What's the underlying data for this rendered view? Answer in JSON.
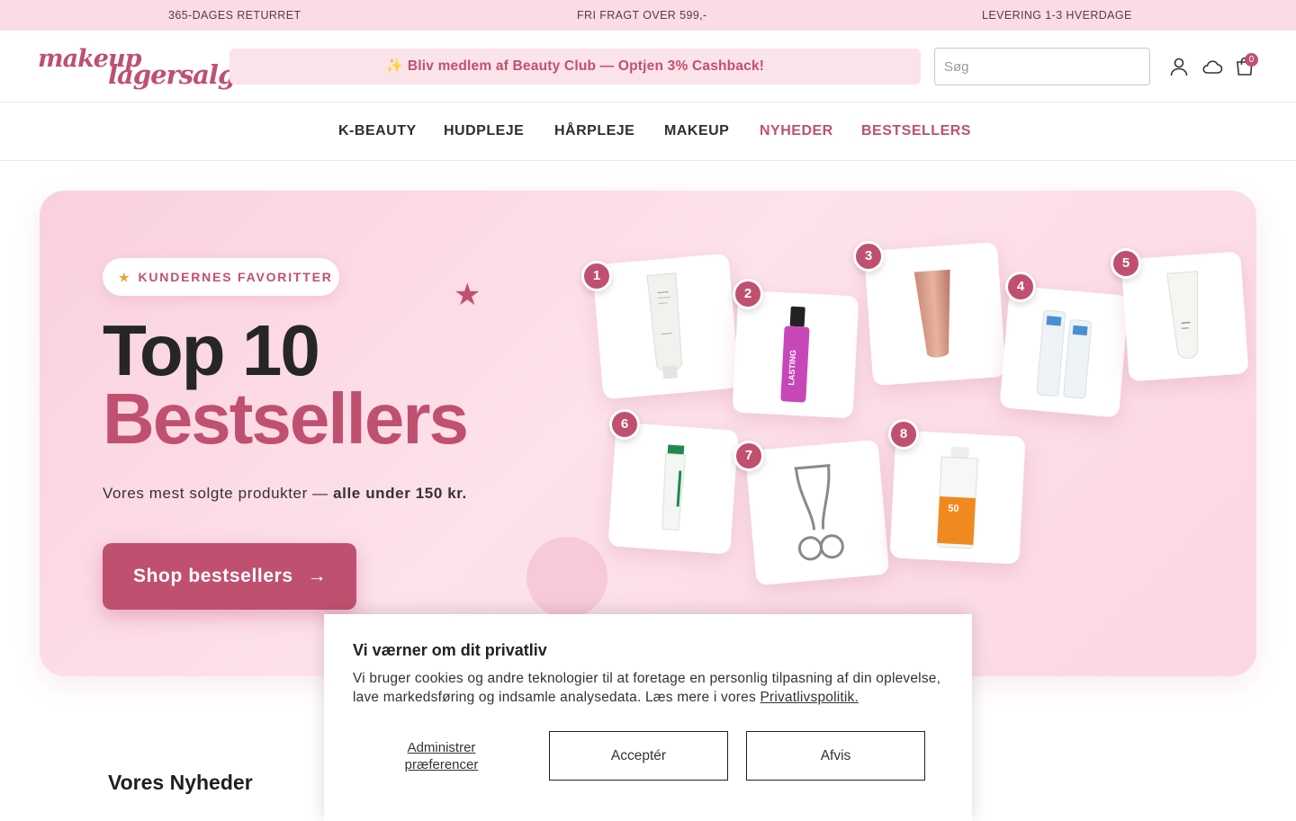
{
  "announcements": [
    "365-DAGES RETURRET",
    "FRI FRAGT OVER 599,-",
    "LEVERING 1-3 HVERDAGE"
  ],
  "logo": {
    "line1": "makeup",
    "line2": "lagersalg"
  },
  "promo": "✨ Bliv medlem af Beauty Club — Optjen 3% Cashback!",
  "search": {
    "placeholder": "Søg"
  },
  "cart": {
    "count": "0"
  },
  "nav": [
    "K-BEAUTY",
    "HUDPLEJE",
    "HÅRPLEJE",
    "MAKEUP",
    "NYHEDER",
    "BESTSELLERS"
  ],
  "hero": {
    "badge": "KUNDERNES FAVORITTER",
    "title_line1": "Top 10",
    "title_line2": "Bestsellers",
    "subtitle_prefix": "Vores mest solgte produkter — ",
    "subtitle_bold": "alle under 150 kr.",
    "cta": "Shop bestsellers",
    "cta_arrow": "→",
    "products": [
      {
        "rank": "1",
        "label": ""
      },
      {
        "rank": "2",
        "label": "LASTING"
      },
      {
        "rank": "3",
        "label": ""
      },
      {
        "rank": "4",
        "label": ""
      },
      {
        "rank": "5",
        "label": ""
      },
      {
        "rank": "6",
        "label": ""
      },
      {
        "rank": "7",
        "label": ""
      },
      {
        "rank": "8",
        "label": "50"
      }
    ]
  },
  "section": {
    "news_title": "Vores Nyheder"
  },
  "cookie": {
    "title": "Vi værner om dit privatliv",
    "text": "Vi bruger cookies og andre teknologier til at foretage en personlig tilpasning af din oplevelse, lave markedsføring og indsamle analysedata. Læs mere i vores ",
    "link": "Privatlivspolitik.",
    "manage": "Administrer præferencer",
    "accept": "Acceptér",
    "decline": "Afvis"
  },
  "colors": {
    "brand": "#c0506f",
    "topbar": "#fbdce6",
    "hero_bg": "#fde2eb"
  }
}
